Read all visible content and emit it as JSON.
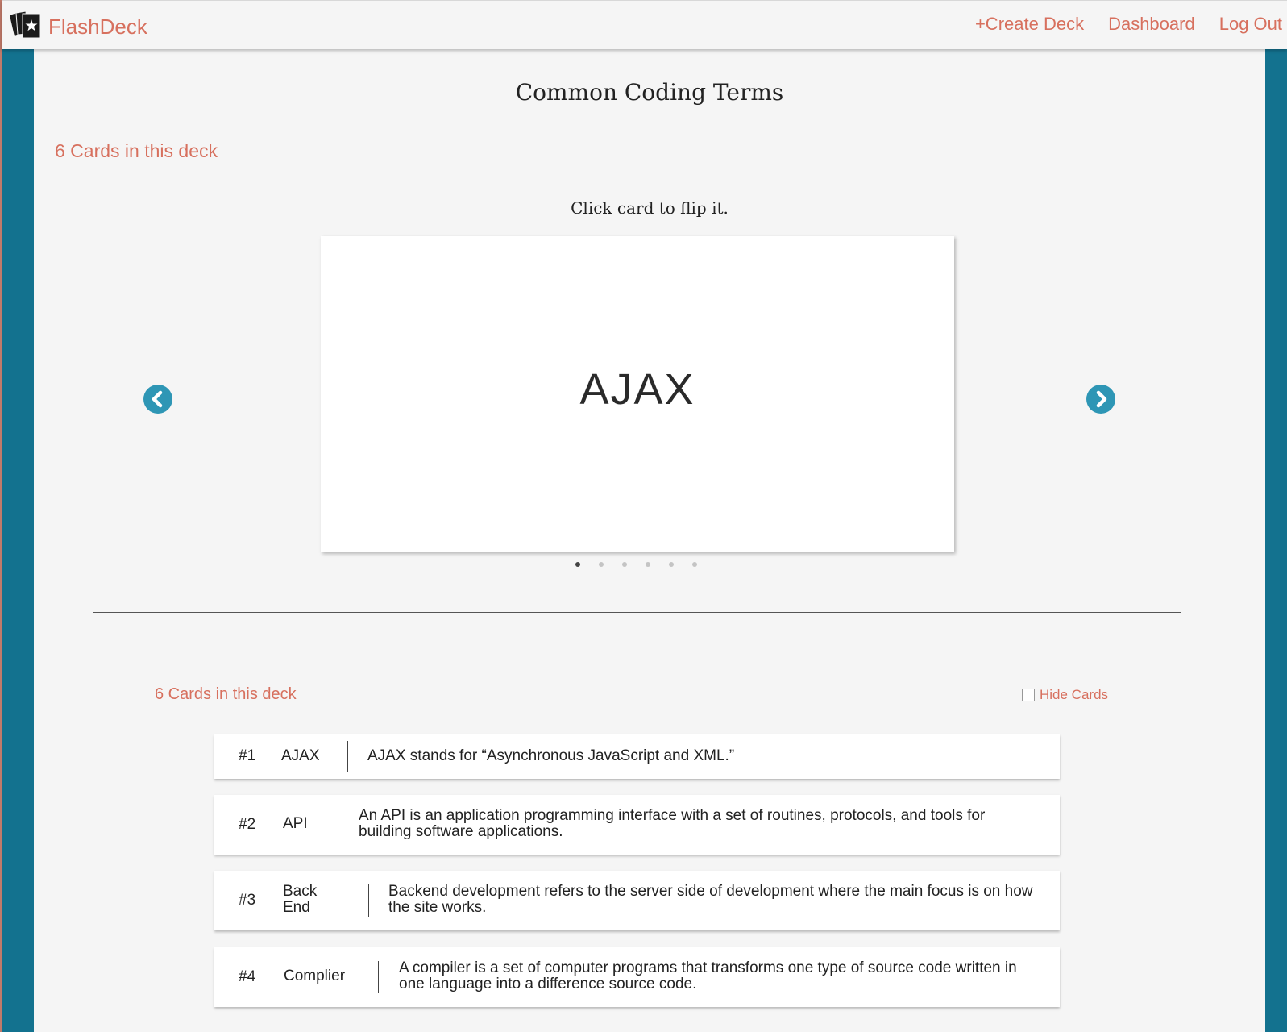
{
  "app": {
    "name": "FlashDeck",
    "logo_icon": "cards-star-icon"
  },
  "nav": {
    "create": "+Create Deck",
    "dashboard": "Dashboard",
    "logout": "Log Out"
  },
  "deck": {
    "title": "Common Coding Terms",
    "count_label": "6 Cards in this deck",
    "hint": "Click card to flip it.",
    "current_card": "AJAX",
    "current_index": 1,
    "total_cards": 6
  },
  "list": {
    "count_label": "6 Cards in this deck",
    "hide_label": "Hide Cards",
    "hide_checked": false,
    "cards": [
      {
        "num": "#1",
        "term": "AJAX",
        "definition": "AJAX stands for “Asynchronous JavaScript and XML.”"
      },
      {
        "num": "#2",
        "term": "API",
        "definition": "An API is an application programming interface with a set of routines, protocols, and tools for building software applications."
      },
      {
        "num": "#3",
        "term": "Back End",
        "definition": "Backend development refers to the server side of development where the main focus is on how the site works."
      },
      {
        "num": "#4",
        "term": "Complier",
        "definition": "A compiler is a set of computer programs that transforms one type of source code written in one language into a difference source code."
      }
    ]
  },
  "colors": {
    "accent": "#d7705e",
    "sidebar": "#13728f",
    "arrow": "#2e96b5",
    "background": "#f5f5f5"
  }
}
